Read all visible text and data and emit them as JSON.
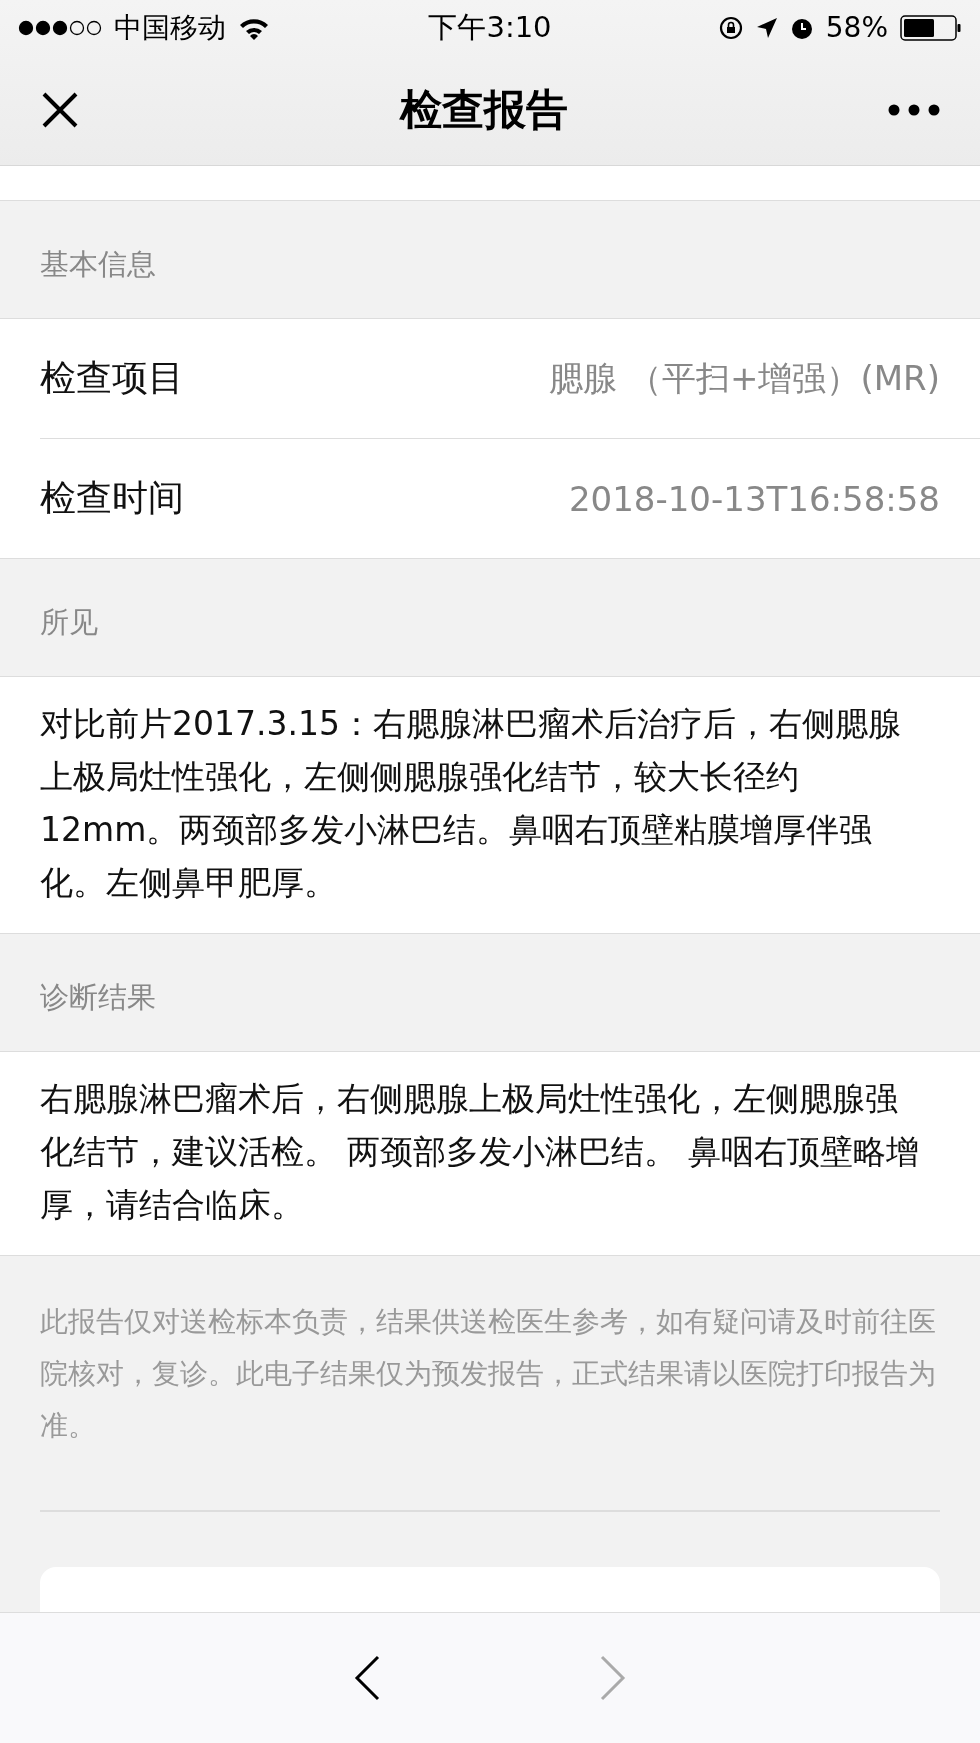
{
  "status_bar": {
    "carrier": "中国移动",
    "time": "下午3:10",
    "battery_percent": "58%"
  },
  "nav_bar": {
    "title": "检查报告"
  },
  "sections": [
    {
      "kind": "fields",
      "header": "基本信息",
      "rows": [
        {
          "label": "检查项目",
          "value": "腮腺 （平扫+增强）(MR)"
        },
        {
          "label": "检查时间",
          "value": "2018-10-13T16:58:58"
        }
      ]
    },
    {
      "kind": "text",
      "header": "所见",
      "text": "对比前片2017.3.15：右腮腺淋巴瘤术后治疗后，右侧腮腺上极局灶性强化，左侧侧腮腺强化结节，较大长径约12mm。两颈部多发小淋巴结。鼻咽右顶壁粘膜增厚伴强化。左侧鼻甲肥厚。"
    },
    {
      "kind": "text",
      "header": "诊断结果",
      "text": "右腮腺淋巴瘤术后，右侧腮腺上极局灶性强化，左侧腮腺强化结节，建议活检。 两颈部多发小淋巴结。 鼻咽右顶壁略增厚，请结合临床。"
    }
  ],
  "disclaimer": "此报告仅对送检标本负责，结果供送检医生参考，如有疑问请及时前往医院核对，复诊。此电子结果仅为预发报告，正式结果请以医院打印报告为准。",
  "toolbar": {
    "back_disabled": false,
    "forward_disabled": true
  }
}
